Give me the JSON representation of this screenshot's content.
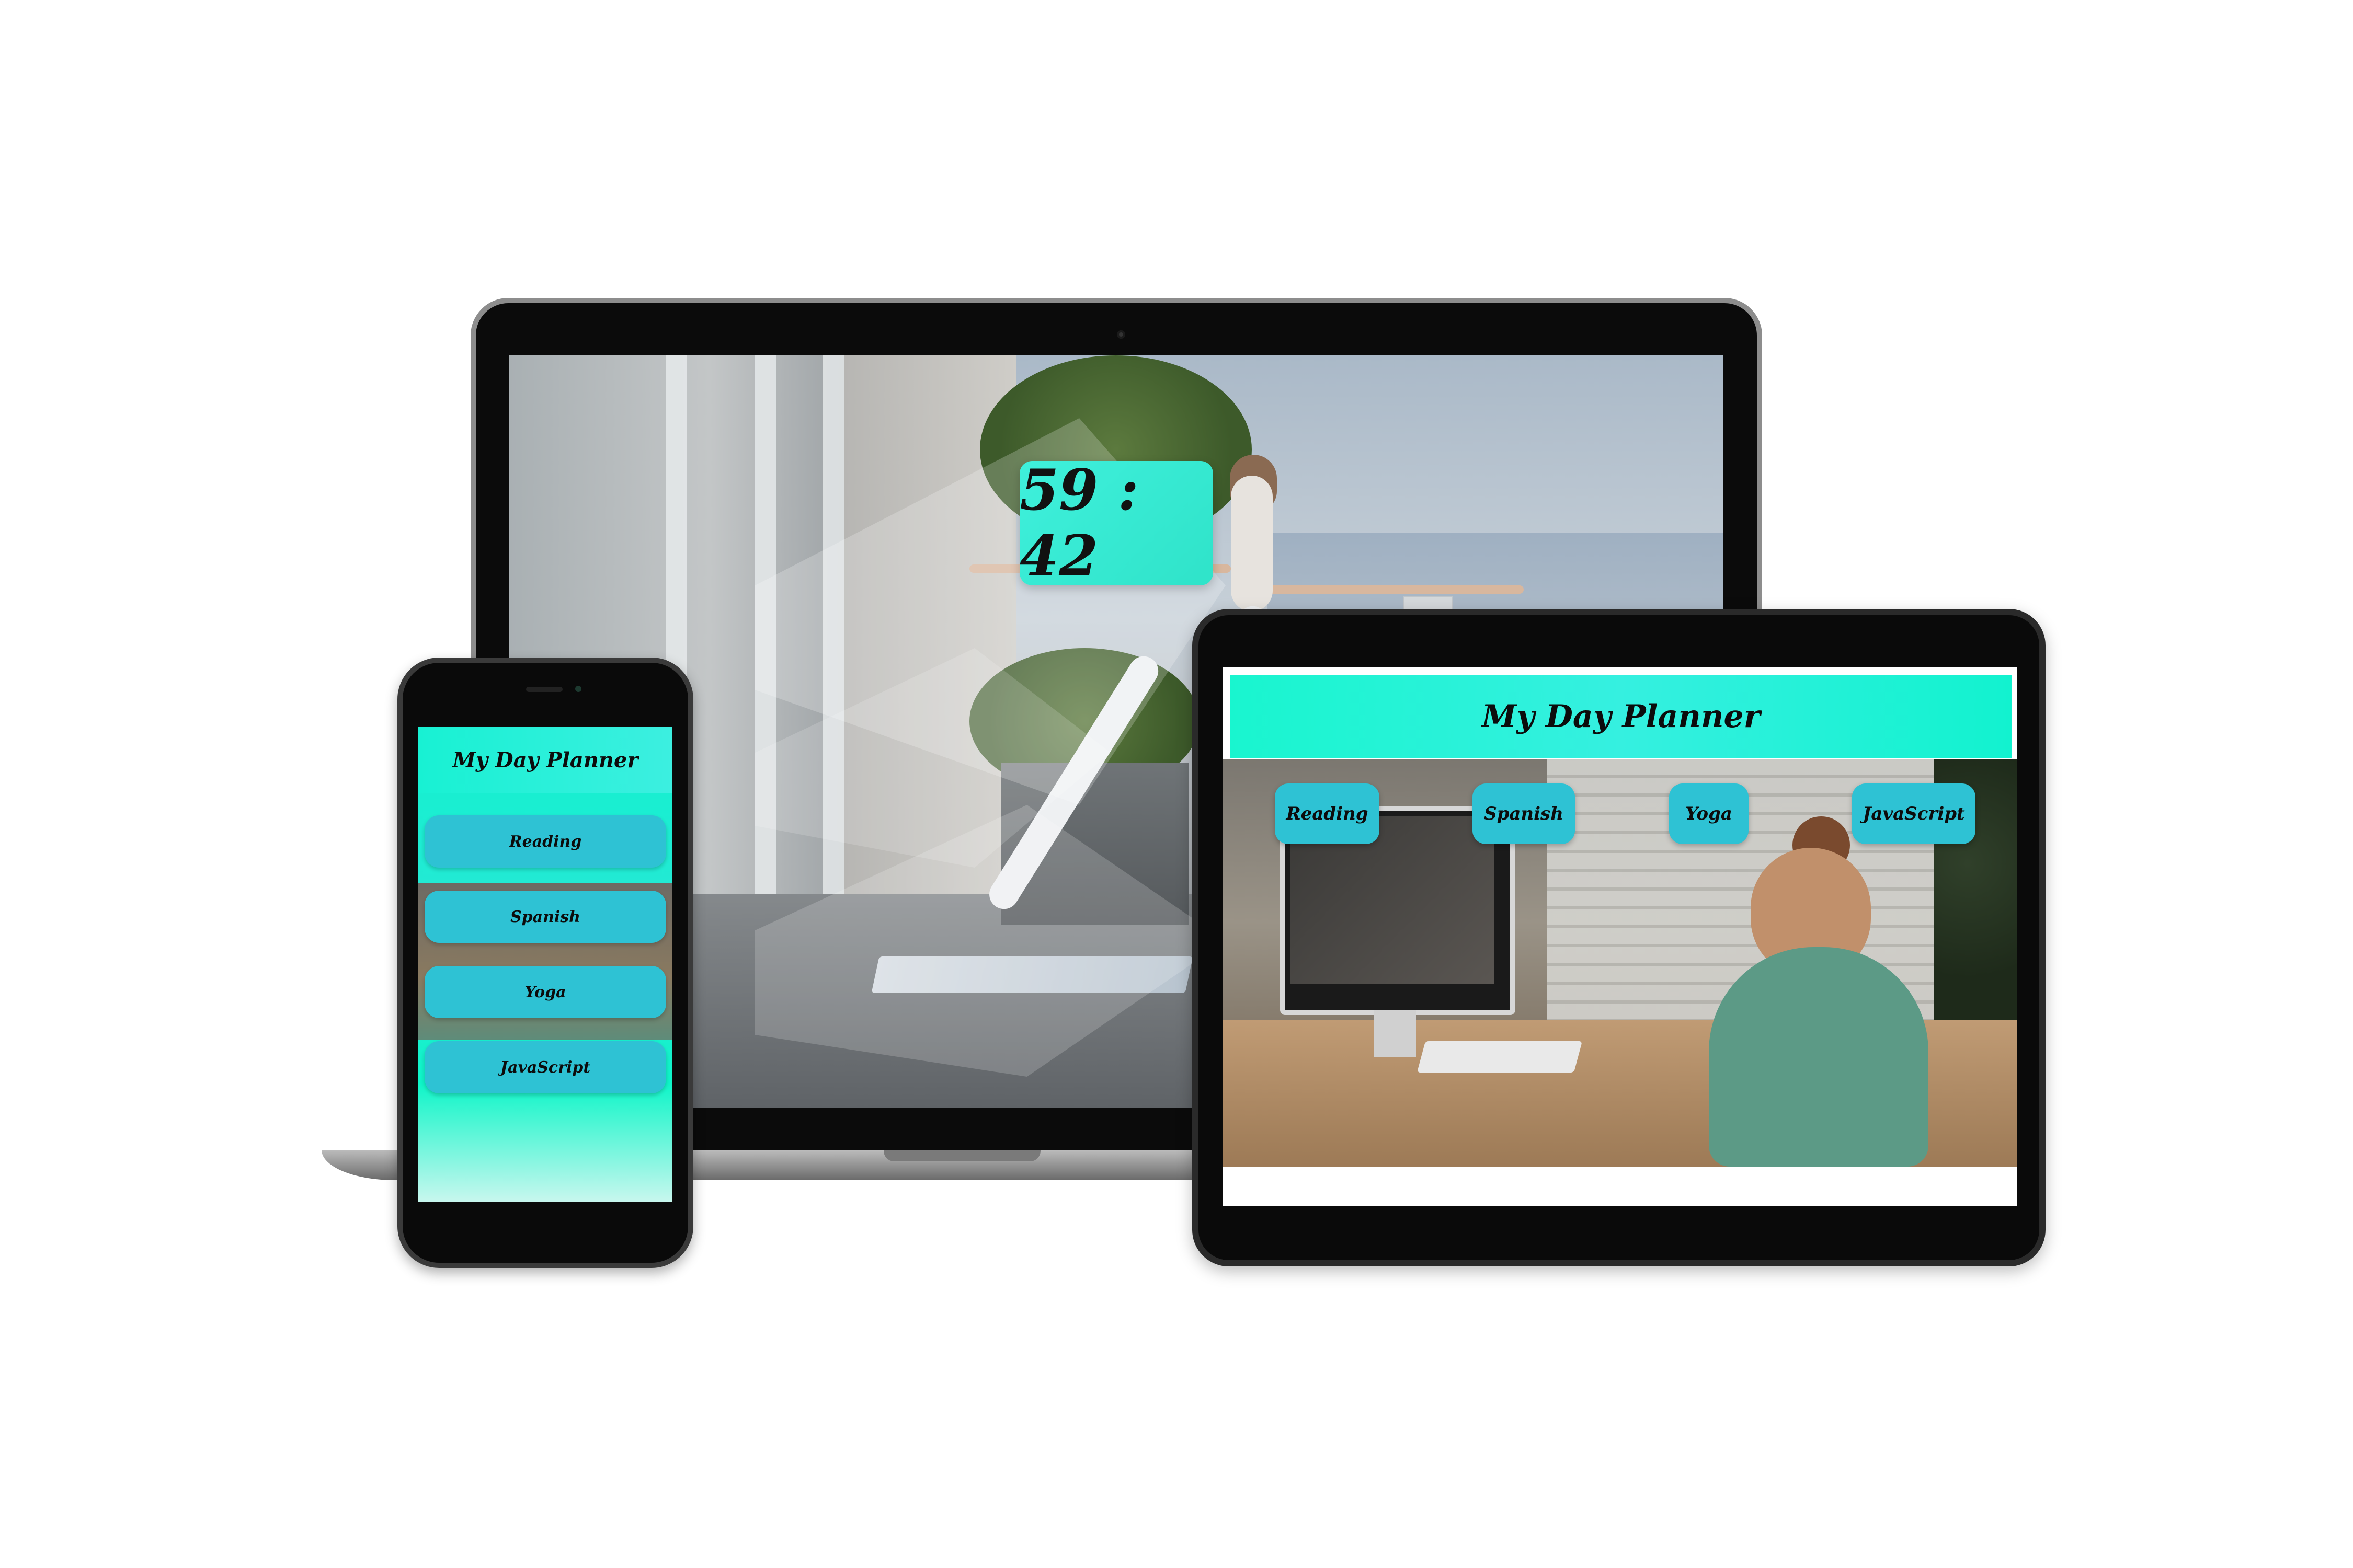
{
  "laptop": {
    "timer": "59 : 42"
  },
  "tablet": {
    "title": "My Day Planner",
    "buttons": [
      {
        "label": "Reading"
      },
      {
        "label": "Spanish"
      },
      {
        "label": "Yoga"
      },
      {
        "label": "JavaScript"
      }
    ]
  },
  "phone": {
    "title": "My Day Planner",
    "buttons": [
      {
        "label": "Reading"
      },
      {
        "label": "Spanish"
      },
      {
        "label": "Yoga"
      },
      {
        "label": "JavaScript"
      }
    ]
  },
  "colors": {
    "accent": "#1ff2d3",
    "button": "#2ec2d4",
    "device_frame": "#0a0a0a"
  },
  "icons": [
    "play-icon",
    "camera-icon"
  ]
}
